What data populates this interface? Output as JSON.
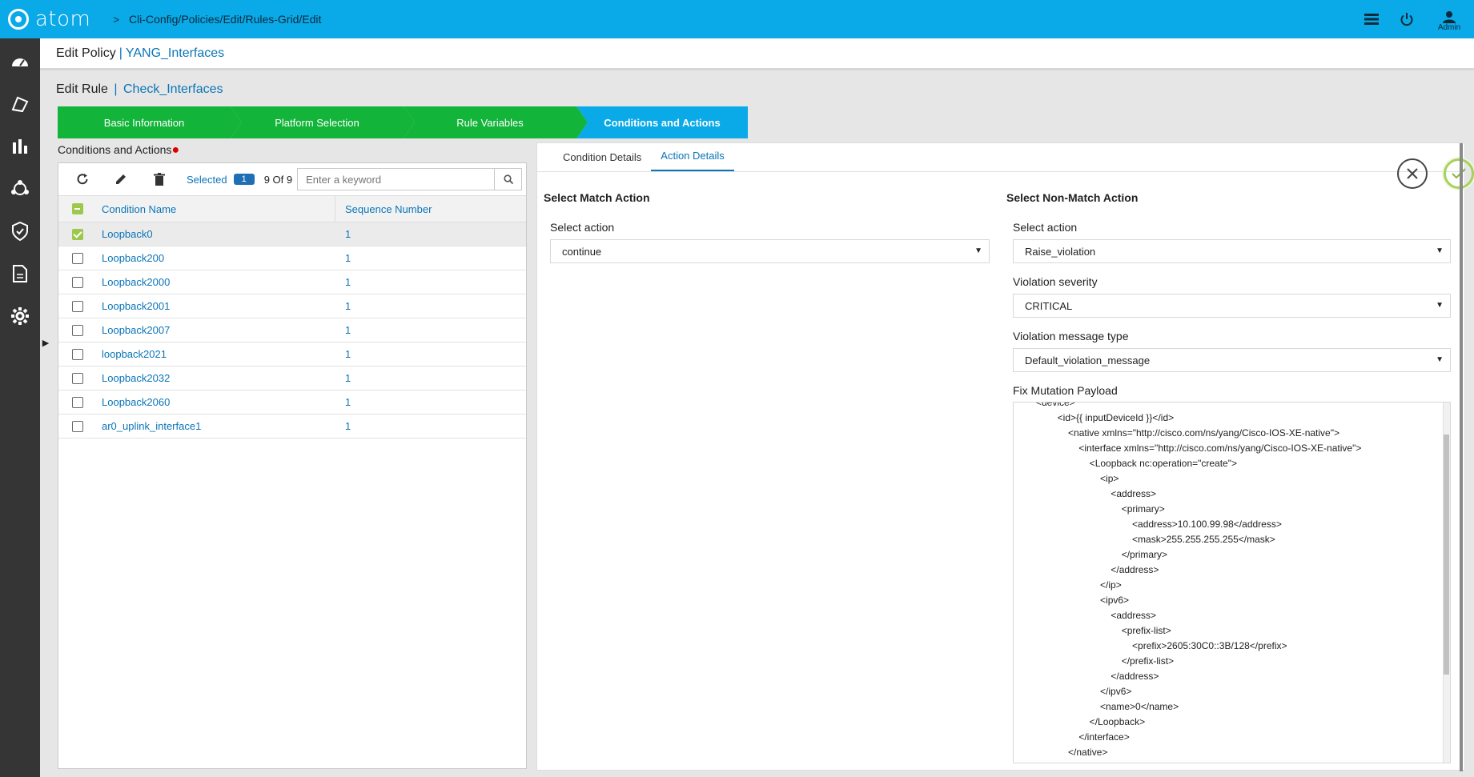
{
  "app": {
    "name": "atom",
    "breadcrumb": "Cli-Config/Policies/Edit/Rules-Grid/Edit",
    "user_label": "Admin"
  },
  "policy": {
    "label": "Edit Policy",
    "separator": "|",
    "name": "YANG_Interfaces"
  },
  "rule": {
    "label": "Edit Rule",
    "separator": "|",
    "name": "Check_Interfaces"
  },
  "wizard": {
    "steps": [
      "Basic Information",
      "Platform Selection",
      "Rule Variables",
      "Conditions and Actions"
    ],
    "active_index": 3
  },
  "conditions": {
    "title": "Conditions and Actions",
    "required_mark": "●",
    "selected_label": "Selected",
    "selected_count": "1",
    "record_count": "9 Of 9",
    "search_placeholder": "Enter a keyword",
    "columns": [
      "Condition Name",
      "Sequence Number"
    ],
    "rows": [
      {
        "name": "Loopback0",
        "seq": "1",
        "checked": true
      },
      {
        "name": "Loopback200",
        "seq": "1",
        "checked": false
      },
      {
        "name": "Loopback2000",
        "seq": "1",
        "checked": false
      },
      {
        "name": "Loopback2001",
        "seq": "1",
        "checked": false
      },
      {
        "name": "Loopback2007",
        "seq": "1",
        "checked": false
      },
      {
        "name": "loopback2021",
        "seq": "1",
        "checked": false
      },
      {
        "name": "Loopback2032",
        "seq": "1",
        "checked": false
      },
      {
        "name": "Loopback2060",
        "seq": "1",
        "checked": false
      },
      {
        "name": "ar0_uplink_interface1",
        "seq": "1",
        "checked": false
      }
    ]
  },
  "details": {
    "tabs": [
      "Condition Details",
      "Action Details"
    ],
    "active_tab": 1,
    "match": {
      "heading": "Select Match Action",
      "action_label": "Select action",
      "action_value": "continue"
    },
    "non_match": {
      "heading": "Select Non-Match Action",
      "action_label": "Select action",
      "action_value": "Raise_violation",
      "severity_label": "Violation severity",
      "severity_value": "CRITICAL",
      "message_type_label": "Violation message type",
      "message_type_value": "Default_violation_message",
      "payload_label": "Fix Mutation Payload",
      "payload_text": "<device>\n        <id>{{ inputDeviceId }}</id>\n            <native xmlns=\"http://cisco.com/ns/yang/Cisco-IOS-XE-native\">\n                <interface xmlns=\"http://cisco.com/ns/yang/Cisco-IOS-XE-native\">\n                    <Loopback nc:operation=\"create\">\n                        <ip>\n                            <address>\n                                <primary>\n                                    <address>10.100.99.98</address>\n                                    <mask>255.255.255.255</mask>\n                                </primary>\n                            </address>\n                        </ip>\n                        <ipv6>\n                            <address>\n                                <prefix-list>\n                                    <prefix>2605:30C0::3B/128</prefix>\n                                </prefix-list>\n                            </address>\n                        </ipv6>\n                        <name>0</name>\n                    </Loopback>\n                </interface>\n            </native>\n    </device>"
    }
  }
}
